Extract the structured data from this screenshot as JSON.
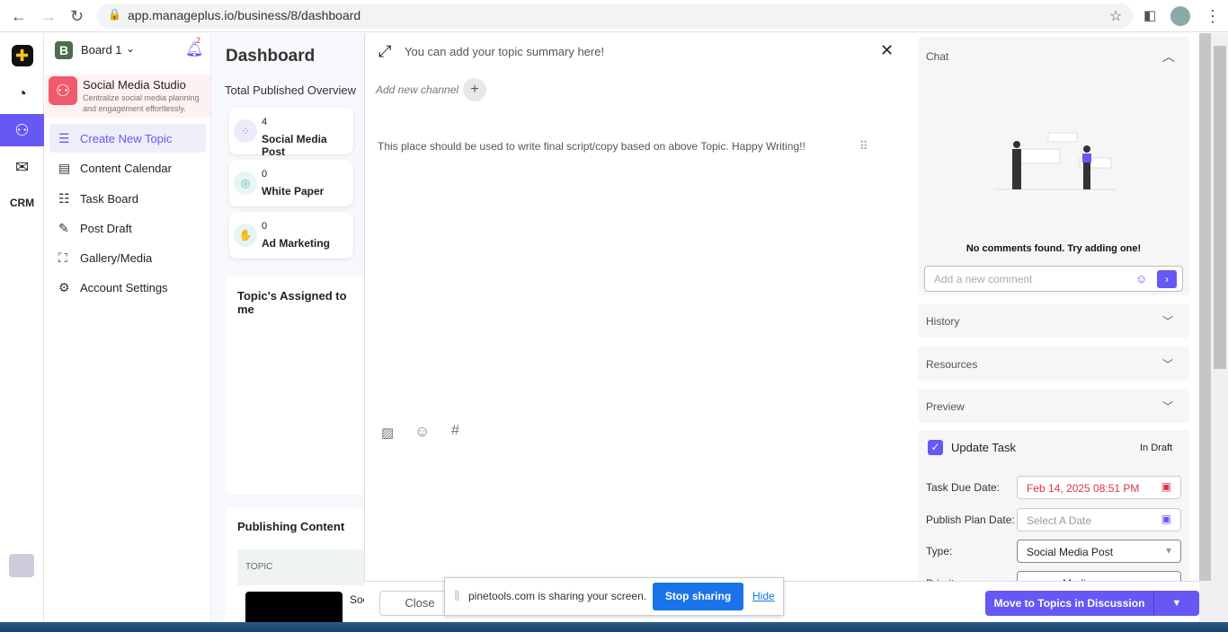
{
  "browser": {
    "url": "app.manageplus.io/business/8/dashboard"
  },
  "header": {
    "board_initial": "B",
    "board": "Board 1",
    "notif_count": "2"
  },
  "app": {
    "name": "Social Media Studio",
    "desc1": "Centralize social media planning",
    "desc2": "and engagement effortlessly."
  },
  "rail": {
    "crm": "CRM"
  },
  "sidebar": {
    "items": [
      {
        "label": "Create New Topic",
        "icon": "add-list"
      },
      {
        "label": "Content Calendar",
        "icon": "calendar"
      },
      {
        "label": "Task Board",
        "icon": "checklist"
      },
      {
        "label": "Post Draft",
        "icon": "edit-doc"
      },
      {
        "label": "Gallery/Media",
        "icon": "image-add"
      },
      {
        "label": "Account Settings",
        "icon": "users-gear"
      }
    ]
  },
  "dashboard": {
    "title": "Dashboard",
    "overview": "Total Published Overview",
    "cards": [
      {
        "count": "4",
        "label": "Social Media Post"
      },
      {
        "count": "0",
        "label": "White Paper"
      },
      {
        "count": "0",
        "label": "Ad Marketing"
      }
    ],
    "assigned": "Topic's Assigned to me",
    "publishing": "Publishing Content",
    "topic_col": "TOPIC",
    "row_snip": "Soc"
  },
  "modal": {
    "summary": "You can add your topic summary here!",
    "add_channel": "Add new channel",
    "body": "This place should be used to write final script/copy based on above Topic. Happy Writing!!"
  },
  "right": {
    "chat": "Chat",
    "no_comments": "No comments found. Try adding one!",
    "comment_placeholder": "Add a new comment",
    "history": "History",
    "resources": "Resources",
    "preview": "Preview",
    "update_task": "Update Task",
    "status": "In Draft",
    "due_label": "Task Due Date:",
    "due_value": "Feb 14, 2025 08:51 PM",
    "plan_label": "Publish Plan Date:",
    "plan_placeholder": "Select A Date",
    "type_label": "Type:",
    "type_value": "Social Media Post",
    "priority_label": "Priority:",
    "priority_value": "Medium"
  },
  "footer": {
    "close": "Close",
    "move": "Move to Topics in Discussion"
  },
  "share": {
    "text": "pinetools.com is sharing your screen.",
    "stop": "Stop sharing",
    "hide": "Hide"
  },
  "colors": {
    "accent": "#6558f5",
    "danger": "#e0324b",
    "share_blue": "#1a73e8"
  }
}
